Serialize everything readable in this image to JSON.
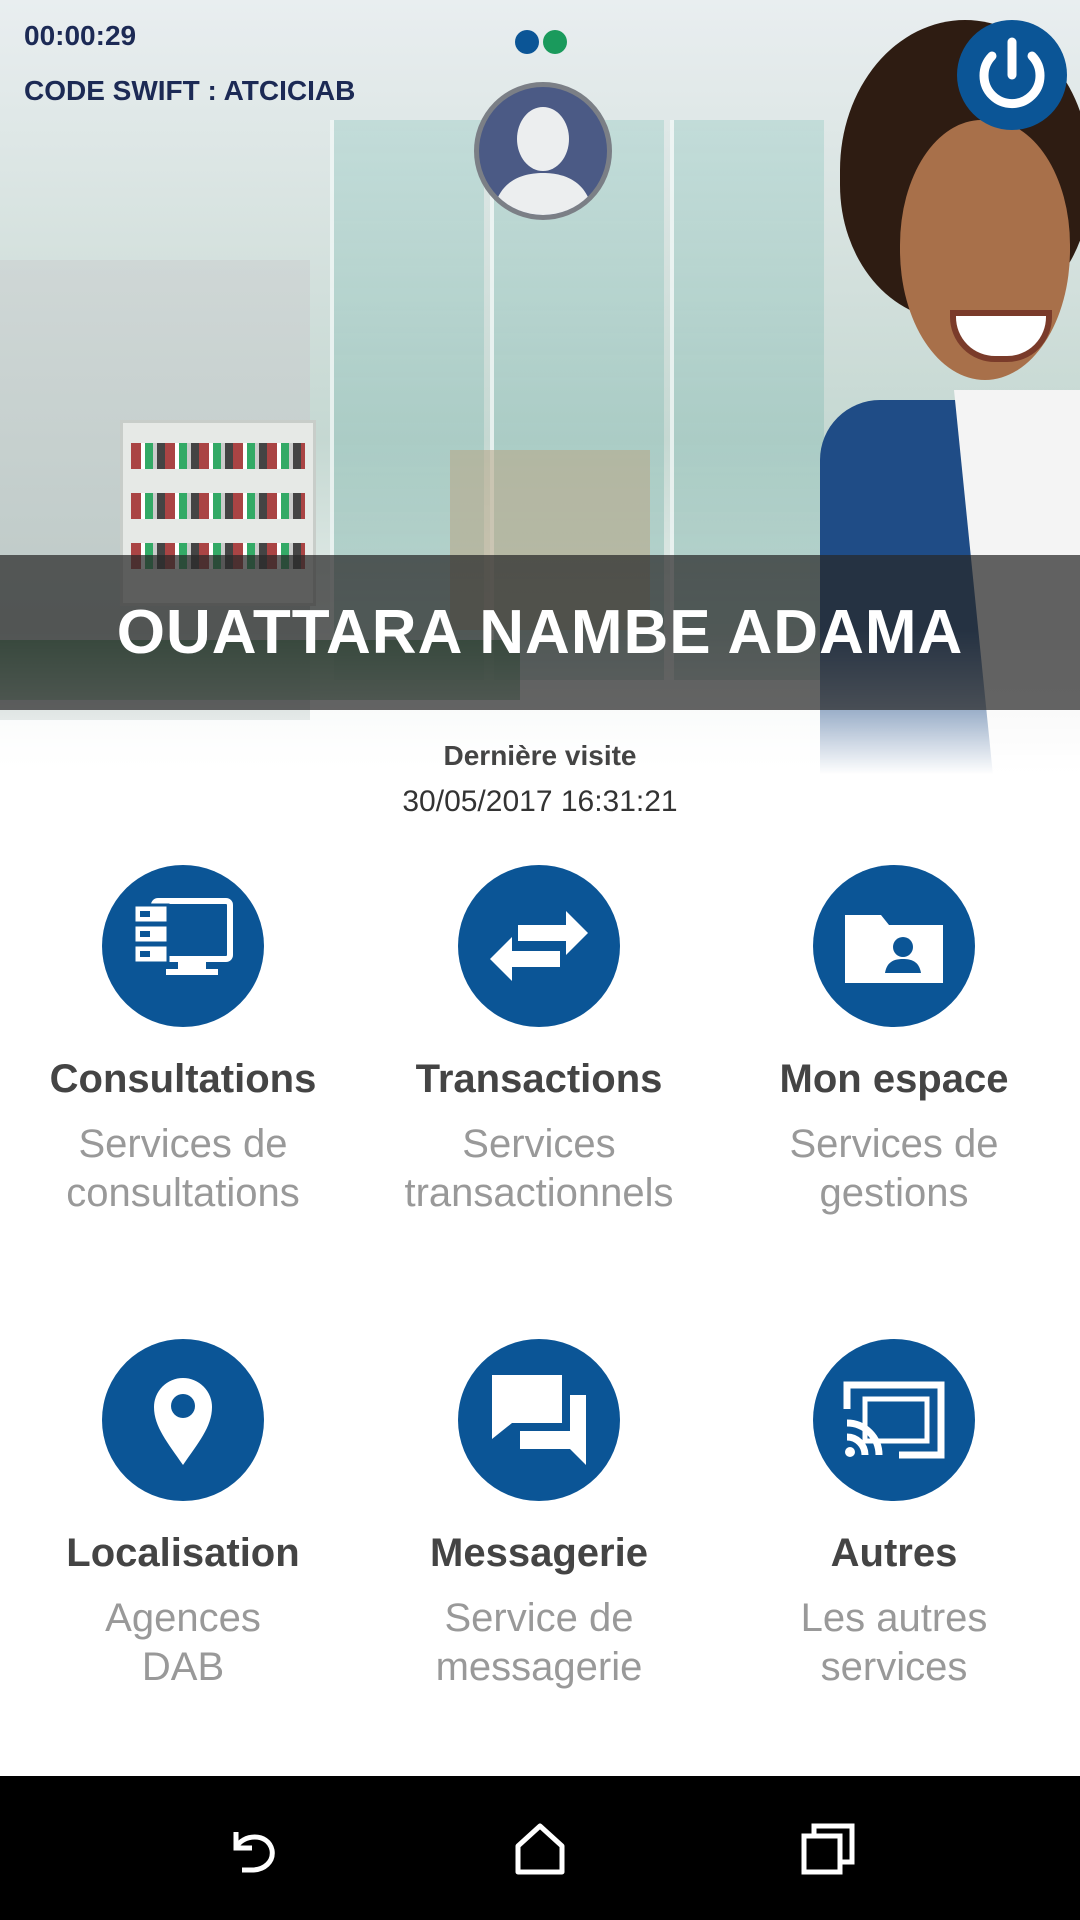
{
  "status": {
    "timer": "00:00:29",
    "swift_code": "CODE SWIFT : ATCICIAB",
    "dot_colors": [
      "#0b5596",
      "#1a9a5c"
    ]
  },
  "user": {
    "name": "OUATTARA NAMBE ADAMA",
    "last_visit_label": "Dernière visite",
    "last_visit_date": "30/05/2017 16:31:21"
  },
  "tiles": [
    {
      "title": "Consultations",
      "sub1": "Services de",
      "sub2": "consultations",
      "icon": "server-monitor-icon"
    },
    {
      "title": "Transactions",
      "sub1": "Services",
      "sub2": "transactionnels",
      "icon": "transfer-arrows-icon"
    },
    {
      "title": "Mon espace",
      "sub1": "Services de",
      "sub2": "gestions",
      "icon": "folder-user-icon"
    },
    {
      "title": "Localisation",
      "sub1": "Agences",
      "sub2": "DAB",
      "icon": "location-pin-icon"
    },
    {
      "title": "Messagerie",
      "sub1": "Service de",
      "sub2": "messagerie",
      "icon": "chat-bubbles-icon"
    },
    {
      "title": "Autres",
      "sub1": "Les autres",
      "sub2": "services",
      "icon": "cast-icon"
    }
  ],
  "colors": {
    "primary": "#0b5596",
    "title_text": "#444444",
    "sub_text": "#999999"
  },
  "navbar": {
    "icons": [
      "back-icon",
      "home-icon",
      "recents-icon"
    ]
  }
}
